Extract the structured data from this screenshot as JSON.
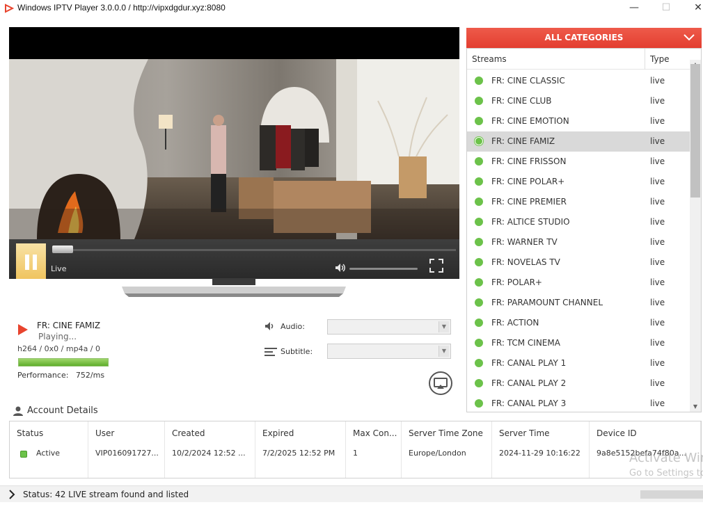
{
  "window": {
    "title": "Windows IPTV Player 3.0.0.0 / http://vipxdgdur.xyz:8080",
    "minimize_label": "—",
    "maximize_label": "☐",
    "close_label": "✕"
  },
  "player": {
    "live_label": "Live",
    "seek_progress": 0.03,
    "volume_level": 0.0
  },
  "now_playing": {
    "channel": "FR: CINE FAMIZ",
    "status": "Playing...",
    "codec": "h264 / 0x0 / mp4a / 0",
    "performance_label": "Performance:",
    "performance_value": "752/ms",
    "performance_fill": 1.0
  },
  "options": {
    "audio_label": "Audio:",
    "subtitle_label": "Subtitle:",
    "audio_value": "",
    "subtitle_value": ""
  },
  "categories": {
    "header": "ALL CATEGORIES",
    "col_streams": "Streams",
    "col_type": "Type",
    "selected_index": 3,
    "items": [
      {
        "name": "FR: CINE CLASSIC",
        "type": "live"
      },
      {
        "name": "FR: CINE CLUB",
        "type": "live"
      },
      {
        "name": "FR: CINE EMOTION",
        "type": "live"
      },
      {
        "name": "FR: CINE FAMIZ",
        "type": "live"
      },
      {
        "name": "FR: CINE FRISSON",
        "type": "live"
      },
      {
        "name": "FR: CINE POLAR+",
        "type": "live"
      },
      {
        "name": "FR: CINE PREMIER",
        "type": "live"
      },
      {
        "name": "FR: ALTICE STUDIO",
        "type": "live"
      },
      {
        "name": "FR: WARNER TV",
        "type": "live"
      },
      {
        "name": "FR: NOVELAS TV",
        "type": "live"
      },
      {
        "name": "FR: POLAR+",
        "type": "live"
      },
      {
        "name": "FR: PARAMOUNT CHANNEL",
        "type": "live"
      },
      {
        "name": "FR: ACTION",
        "type": "live"
      },
      {
        "name": "FR: TCM CINEMA",
        "type": "live"
      },
      {
        "name": "FR: CANAL PLAY 1",
        "type": "live"
      },
      {
        "name": "FR: CANAL PLAY 2",
        "type": "live"
      },
      {
        "name": "FR: CANAL PLAY 3",
        "type": "live"
      }
    ]
  },
  "account": {
    "title": "Account Details",
    "columns": [
      {
        "header": "Status",
        "value": "Active"
      },
      {
        "header": "User",
        "value": "VIP016091727..."
      },
      {
        "header": "Created",
        "value": "10/2/2024 12:52 ..."
      },
      {
        "header": "Expired",
        "value": "7/2/2025 12:52 PM"
      },
      {
        "header": "Max Con...",
        "value": "1"
      },
      {
        "header": "Server Time Zone",
        "value": "Europe/London"
      },
      {
        "header": "Server Time",
        "value": "2024-11-29 10:16:22"
      },
      {
        "header": "Device ID",
        "value": "9a8e5152befa74f80a..."
      }
    ]
  },
  "watermark": {
    "line1": "Activate Win",
    "line2": "Go to Settings to"
  },
  "statusbar": {
    "text": "Status: 42 LIVE stream found and listed"
  },
  "colors": {
    "accent": "#e8442e",
    "live_dot": "#6cc24a",
    "pause_button": "#f3cd74"
  }
}
